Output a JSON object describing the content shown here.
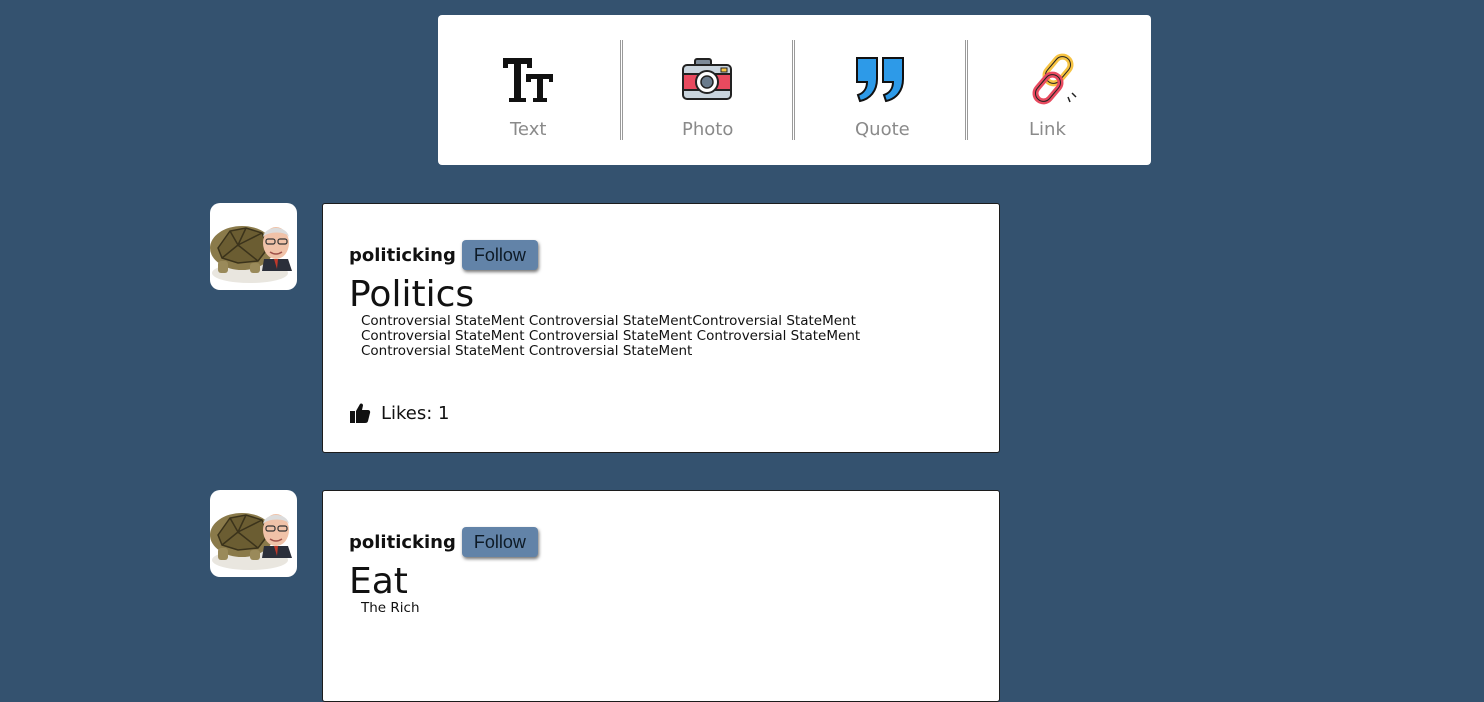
{
  "composer": {
    "types": [
      {
        "label": "Text",
        "icon": "text-format-icon"
      },
      {
        "label": "Photo",
        "icon": "camera-icon"
      },
      {
        "label": "Quote",
        "icon": "quote-icon"
      },
      {
        "label": "Link",
        "icon": "chain-link-icon"
      }
    ]
  },
  "posts": [
    {
      "username": "politicking",
      "follow_label": "Follow",
      "title": "Politics",
      "body": "Controversial StateMent Controversial StateMentControversial StateMent Controversial StateMent Controversial StateMent Controversial StateMent Controversial StateMent Controversial StateMent",
      "likes_label": "Likes: 1",
      "avatar_icon": "tortoise-avatar"
    },
    {
      "username": "politicking",
      "follow_label": "Follow",
      "title": "Eat",
      "body": "The Rich",
      "avatar_icon": "tortoise-avatar"
    }
  ],
  "colors": {
    "background": "#34526f",
    "follow_button": "#6283a8",
    "label_gray": "#8a8a8a"
  }
}
